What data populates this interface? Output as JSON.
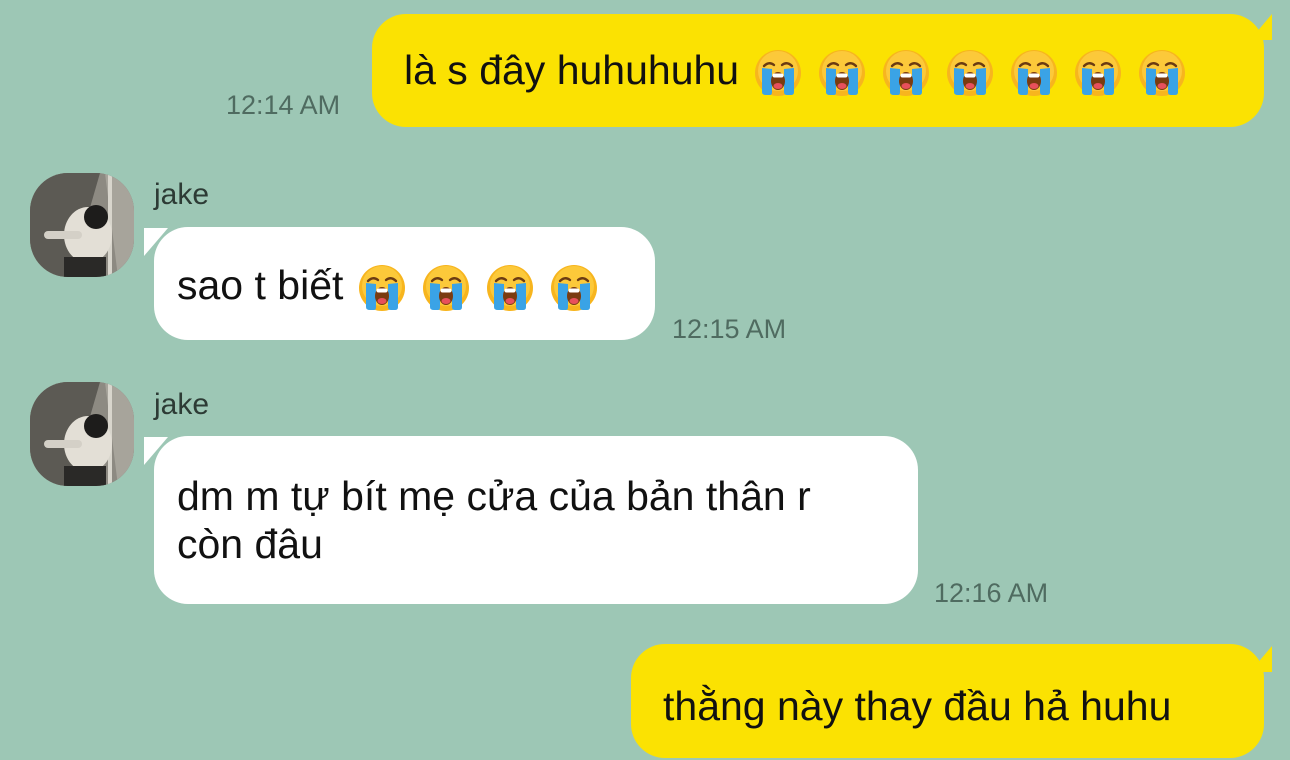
{
  "messages": [
    {
      "direction": "outgoing",
      "text": "là s đây huhuhuhu",
      "emoji_count": 7,
      "emoji": "loudly-crying-face",
      "time": "12:14 AM"
    },
    {
      "direction": "incoming",
      "sender": "jake",
      "text": "sao t biết",
      "emoji_count": 4,
      "emoji": "loudly-crying-face",
      "time": "12:15 AM"
    },
    {
      "direction": "incoming",
      "sender": "jake",
      "text_line1": "dm m tự bít mẹ cửa của bản thân r",
      "text_line2": "còn đâu",
      "time": "12:16 AM"
    },
    {
      "direction": "outgoing",
      "text": "thằng này thay đầu hả huhu"
    }
  ],
  "colors": {
    "background": "#9dc7b5",
    "outgoing_bubble": "#fbe202",
    "incoming_bubble": "#ffffff",
    "time_text": "#4f6b60"
  }
}
